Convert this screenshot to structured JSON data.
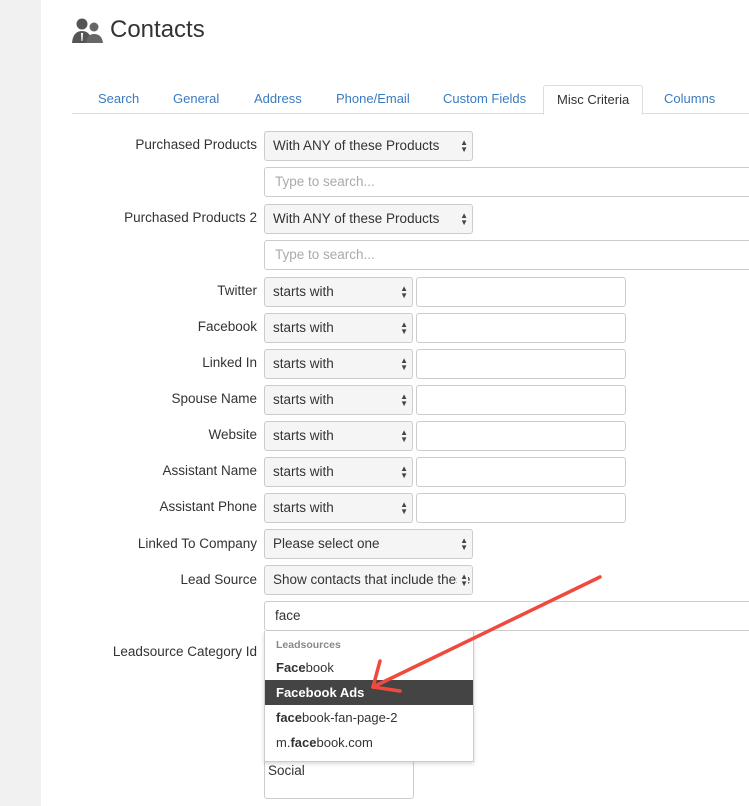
{
  "header": {
    "title": "Contacts",
    "icon": "contacts-icon"
  },
  "tabs": [
    {
      "label": "Search"
    },
    {
      "label": "General"
    },
    {
      "label": "Address"
    },
    {
      "label": "Phone/Email"
    },
    {
      "label": "Custom Fields"
    },
    {
      "label": "Misc Criteria",
      "active": true
    },
    {
      "label": "Columns"
    }
  ],
  "form": {
    "purchased_products": {
      "label": "Purchased Products",
      "select": "With ANY of these Products",
      "placeholder": "Type to search..."
    },
    "purchased_products_2": {
      "label": "Purchased Products 2",
      "select": "With ANY of these Products",
      "placeholder": "Type to search..."
    },
    "text_rows": [
      {
        "label": "Twitter",
        "op": "starts with",
        "value": ""
      },
      {
        "label": "Facebook",
        "op": "starts with",
        "value": ""
      },
      {
        "label": "Linked In",
        "op": "starts with",
        "value": ""
      },
      {
        "label": "Spouse Name",
        "op": "starts with",
        "value": ""
      },
      {
        "label": "Website",
        "op": "starts with",
        "value": ""
      },
      {
        "label": "Assistant Name",
        "op": "starts with",
        "value": ""
      },
      {
        "label": "Assistant Phone",
        "op": "starts with",
        "value": ""
      }
    ],
    "linked_company": {
      "label": "Linked To Company",
      "select": "Please select one"
    },
    "lead_source": {
      "label": "Lead Source",
      "select": "Show contacts that include these"
    },
    "leadsource_search": {
      "value": "face"
    },
    "leadsource_category": {
      "label": "Leadsource Category Id",
      "value": "Social"
    },
    "dropdown": {
      "group": "Leadsources",
      "options": [
        {
          "match": "Face",
          "rest": "book",
          "pre": ""
        },
        {
          "match": "Face",
          "rest": "book Ads",
          "pre": "",
          "highlighted": true
        },
        {
          "match": "face",
          "rest": "book-fan-page-2",
          "pre": ""
        },
        {
          "match": "face",
          "rest": "book.com",
          "pre": "m."
        }
      ]
    }
  },
  "annotation": {
    "arrow_color": "#f04a3e"
  }
}
